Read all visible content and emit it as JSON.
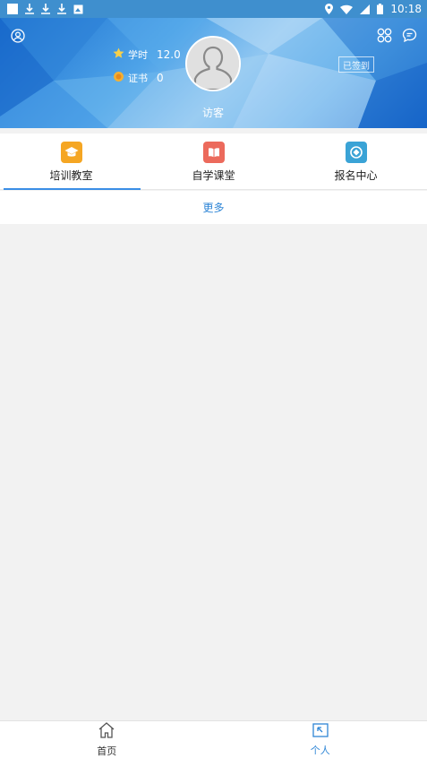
{
  "status_bar": {
    "time": "10:18",
    "colors": {
      "background": "#3f8fce"
    }
  },
  "header": {
    "study_hours": {
      "label": "学时",
      "value": "12.0"
    },
    "certificates": {
      "label": "证书",
      "value": "0"
    },
    "username": "访客",
    "signin_badge": "已签到",
    "icons": [
      "user-circle-icon",
      "grid-icon",
      "message-icon",
      "star-icon",
      "medal-icon",
      "default-avatar-icon"
    ]
  },
  "tabs": [
    {
      "label": "培训教室",
      "icon": "graduation-cap-icon",
      "color": "#f5a623",
      "active": true
    },
    {
      "label": "自学课堂",
      "icon": "open-book-icon",
      "color": "#ec6a5c",
      "active": false
    },
    {
      "label": "报名中心",
      "icon": "register-center-icon",
      "color": "#3aa3d6",
      "active": false
    }
  ],
  "more": {
    "label": "更多"
  },
  "bottom_nav": {
    "items": [
      {
        "label": "首页",
        "icon": "home-icon",
        "active": false
      },
      {
        "label": "个人",
        "icon": "personal-icon",
        "active": true
      }
    ]
  },
  "colors": {
    "accent": "#2f86d6",
    "page_background": "#f2f2f2"
  }
}
